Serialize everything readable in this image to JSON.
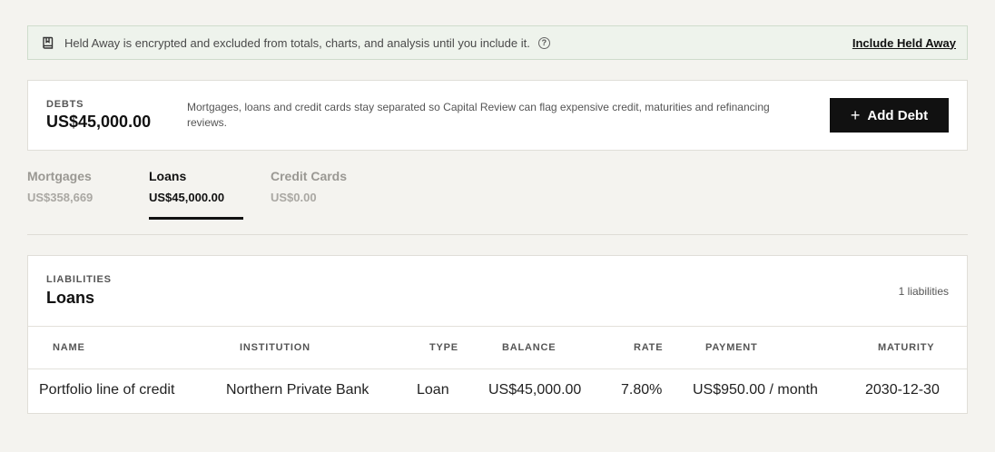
{
  "banner": {
    "icon": "book-icon",
    "message": "Held Away is encrypted and excluded from totals, charts, and analysis until you include it.",
    "help_icon_glyph": "?",
    "action_label": "Include Held Away"
  },
  "debts": {
    "label": "DEBTS",
    "total": "US$45,000.00",
    "description": "Mortgages, loans and credit cards stay separated so Capital Review can flag expensive credit, maturities and refinancing reviews.",
    "add_button_label": "Add Debt",
    "add_button_icon": "+"
  },
  "tabs": [
    {
      "name": "Mortgages",
      "value": "US$358,669",
      "active": false
    },
    {
      "name": "Loans",
      "value": "US$45,000.00",
      "active": true
    },
    {
      "name": "Credit Cards",
      "value": "US$0.00",
      "active": false
    }
  ],
  "liabilities": {
    "label": "LIABILITIES",
    "title": "Loans",
    "count": "1 liabilities",
    "columns": [
      "NAME",
      "INSTITUTION",
      "TYPE",
      "BALANCE",
      "RATE",
      "PAYMENT",
      "MATURITY"
    ],
    "rows": [
      {
        "name": "Portfolio line of credit",
        "institution": "Northern Private Bank",
        "type": "Loan",
        "balance": "US$45,000.00",
        "rate": "7.80%",
        "payment": "US$950.00 / month",
        "maturity": "2030-12-30"
      }
    ]
  },
  "colors": {
    "background": "#f4f3ef",
    "banner_bg": "#eef3ec",
    "primary_button": "#111111",
    "active_tab": "#111111",
    "inactive_tab": "#9a9893"
  }
}
